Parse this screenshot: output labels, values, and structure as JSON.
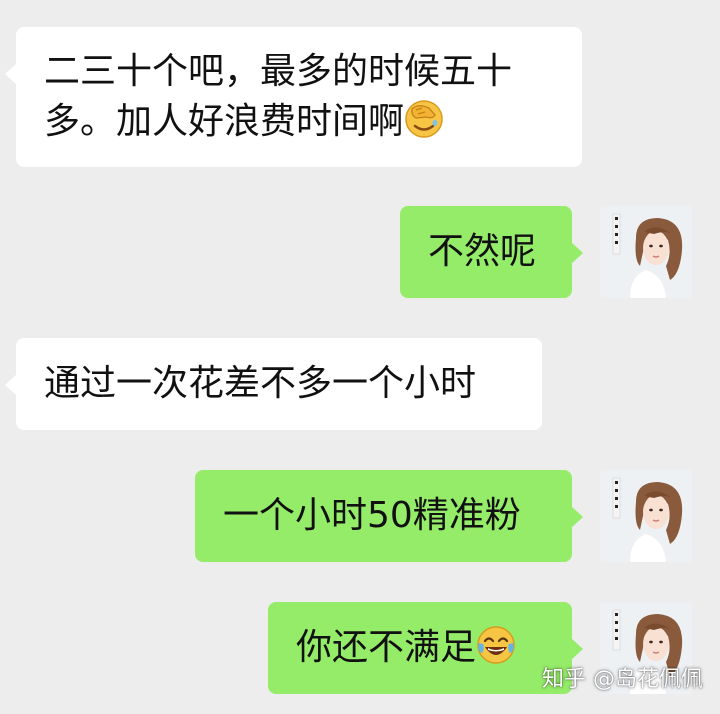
{
  "messages": [
    {
      "side": "left",
      "lines": [
        "二三十个吧，最多的时候五十",
        "多。加人好浪费时间啊"
      ],
      "emoji": "face-palm-emoji"
    },
    {
      "side": "right",
      "lines": [
        "不然呢"
      ]
    },
    {
      "side": "left",
      "lines": [
        "通过一次花差不多一个小时"
      ]
    },
    {
      "side": "right",
      "lines": [
        "一个小时50精准粉"
      ]
    },
    {
      "side": "right",
      "lines": [
        "你还不满足"
      ],
      "emoji": "tears-of-joy-emoji"
    }
  ],
  "avatar": {
    "stamp_text": "岛花佩佩"
  },
  "watermark": {
    "text": "知乎 @岛花佩佩"
  },
  "colors": {
    "background": "#ededed",
    "incoming_bubble": "#ffffff",
    "outgoing_bubble": "#95ec69",
    "text": "#111111"
  }
}
